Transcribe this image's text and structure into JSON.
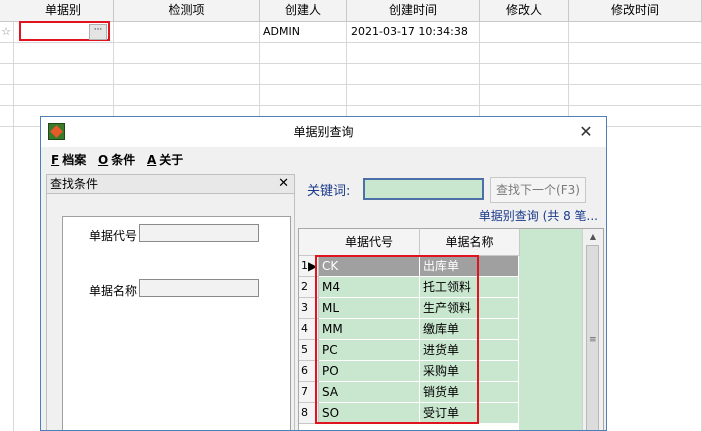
{
  "grid": {
    "columns": [
      "单据别",
      "检测项",
      "创建人",
      "创建时间",
      "修改人",
      "修改时间"
    ],
    "new_row_marker": "☆",
    "row": {
      "type": "",
      "check_item": "",
      "creator": "ADMIN",
      "created_at": "2021-03-17 10:34:38",
      "modifier": "",
      "modified_at": ""
    },
    "ellipsis_label": "···"
  },
  "dialog": {
    "title": "单据别查询",
    "close_glyph": "✕",
    "menu": [
      {
        "key": "F",
        "label": "档案"
      },
      {
        "key": "O",
        "label": "条件"
      },
      {
        "key": "A",
        "label": "关于"
      }
    ],
    "left_panel": {
      "title": "查找条件",
      "close_glyph": "✕",
      "fields": [
        {
          "label": "单据代号",
          "value": ""
        },
        {
          "label": "单据名称",
          "value": ""
        }
      ]
    },
    "search": {
      "keyword_label": "关键词:",
      "keyword_value": "",
      "find_next_label": "查找下一个(F3)",
      "result_summary": "单据别查询 (共 8 笔..."
    },
    "table": {
      "headers": [
        "单据代号",
        "单据名称"
      ],
      "selected_index": 0,
      "rows": [
        {
          "num": "1",
          "code": "CK",
          "name": "出库单"
        },
        {
          "num": "2",
          "code": "M4",
          "name": "托工领料"
        },
        {
          "num": "3",
          "code": "ML",
          "name": "生产领料"
        },
        {
          "num": "4",
          "code": "MM",
          "name": "缴库单"
        },
        {
          "num": "5",
          "code": "PC",
          "name": "进货单"
        },
        {
          "num": "6",
          "code": "PO",
          "name": "采购单"
        },
        {
          "num": "7",
          "code": "SA",
          "name": "销货单"
        },
        {
          "num": "8",
          "code": "SO",
          "name": "受订单"
        }
      ]
    }
  },
  "colors": {
    "highlight": "#e0141e",
    "grid_green": "#c9e7cf",
    "selected_row": "#a0a0a0",
    "link_blue": "#1a3a8a"
  }
}
